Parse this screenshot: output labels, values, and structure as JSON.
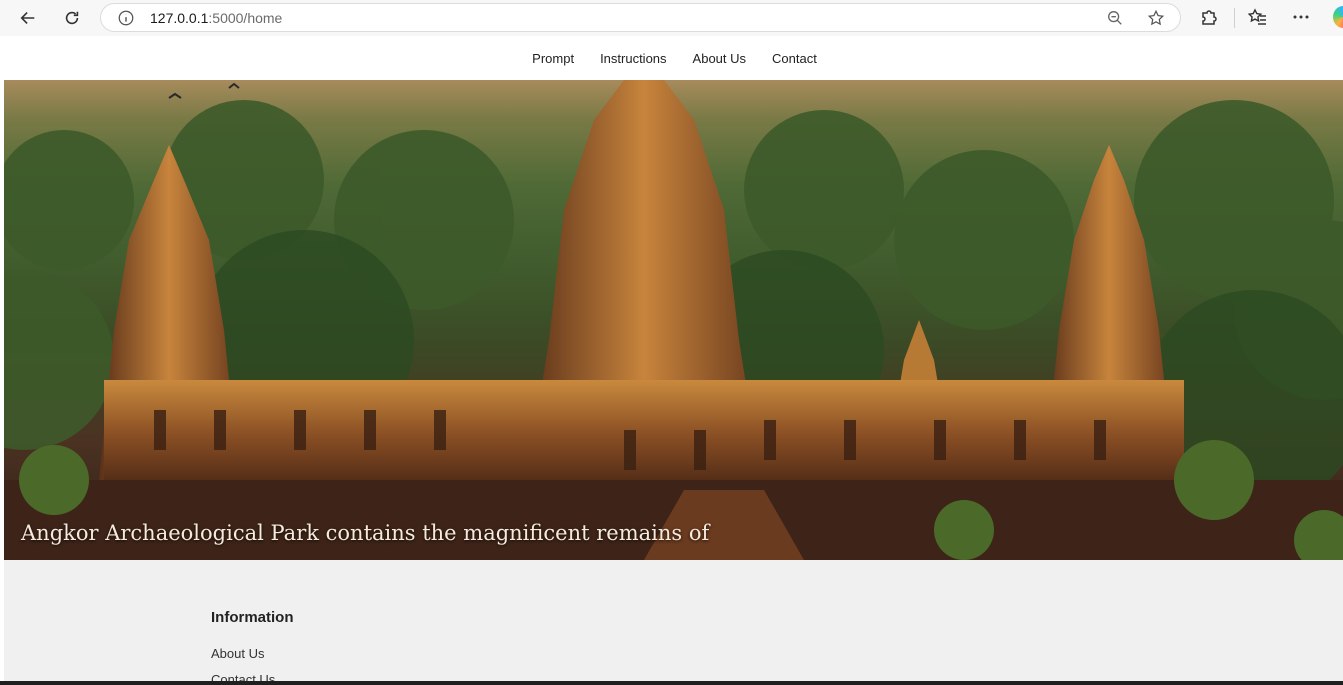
{
  "browser": {
    "url_host": "127.0.0.1",
    "url_path": ":5000/home"
  },
  "nav": {
    "items": [
      "Prompt",
      "Instructions",
      "About Us",
      "Contact"
    ]
  },
  "hero": {
    "caption": "Angkor Archaeological Park contains the magnificent remains of"
  },
  "footer": {
    "heading": "Information",
    "links": [
      "About Us",
      "Contact Us"
    ]
  },
  "colors": {
    "page_bg": "#f0f0f0",
    "nav_bg": "#ffffff"
  }
}
